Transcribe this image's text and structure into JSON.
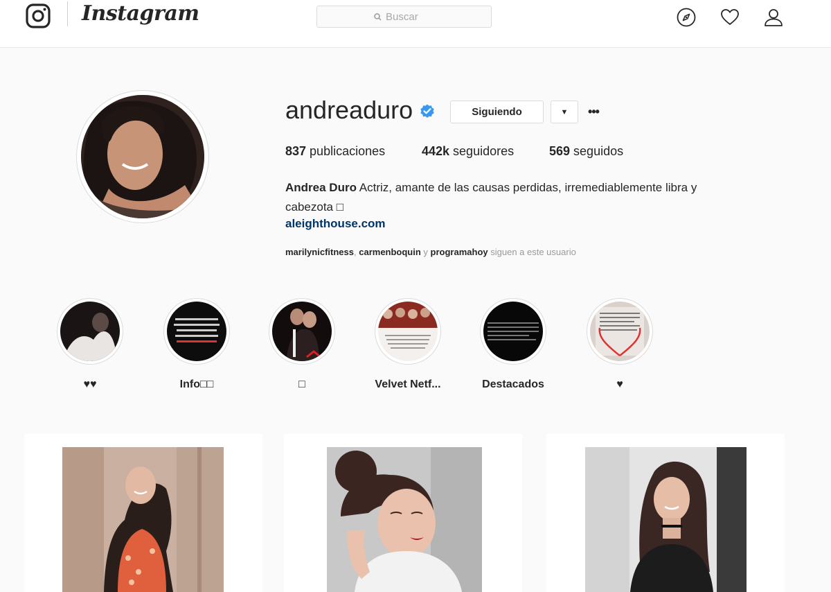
{
  "nav": {
    "logo_text": "Instagram",
    "search_placeholder": "Buscar",
    "icons": [
      "instagram-camera-icon",
      "search-icon",
      "compass-icon",
      "heart-icon",
      "user-icon"
    ]
  },
  "profile": {
    "username": "andreaduro",
    "verified": true,
    "follow_button": "Siguiendo",
    "dropdown_glyph": "▼",
    "more_glyph": "•••",
    "stats": {
      "posts_count": "837",
      "posts_label": " publicaciones",
      "followers_count": "442k",
      "followers_label": " seguidores",
      "following_count": "569",
      "following_label": " seguidos"
    },
    "bio": {
      "full_name": "Andrea Duro",
      "text": " Actriz, amante de las causas perdidas, irremediablemente libra y cabezota □"
    },
    "website": "aleighthouse.com",
    "followed_by": {
      "user1": "marilynicfitness",
      "sep1": ", ",
      "user2": "carmenboquin",
      "sep2": " y ",
      "user3": "programahoy",
      "suffix": " siguen a este usuario"
    }
  },
  "highlights": [
    {
      "label": "♥♥"
    },
    {
      "label": "Info□□"
    },
    {
      "label": "□"
    },
    {
      "label": "Velvet Netf..."
    },
    {
      "label": "Destacados"
    },
    {
      "label": "♥"
    }
  ],
  "colors": {
    "background": "#fafafa",
    "text": "#262626",
    "link": "#003569",
    "verified": "#3897f0",
    "border": "#dbdbdb"
  }
}
